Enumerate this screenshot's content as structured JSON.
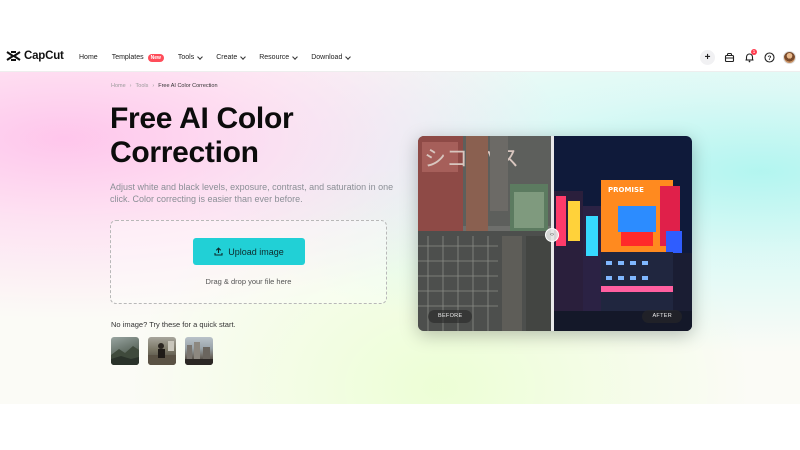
{
  "brand": {
    "name": "CapCut"
  },
  "nav": {
    "items": [
      {
        "label": "Home",
        "dropdown": false
      },
      {
        "label": "Templates",
        "dropdown": false,
        "badge": "New"
      },
      {
        "label": "Tools",
        "dropdown": true
      },
      {
        "label": "Create",
        "dropdown": true
      },
      {
        "label": "Resource",
        "dropdown": true
      },
      {
        "label": "Download",
        "dropdown": true
      }
    ],
    "right": {
      "add_icon": "plus-icon",
      "bag_icon": "bag-icon",
      "bell_icon": "bell-icon",
      "bell_count": "1",
      "help_icon": "help-icon",
      "avatar": "avatar"
    }
  },
  "breadcrumb": [
    "Home",
    "Tools",
    "Free AI Color Correction"
  ],
  "hero": {
    "title": "Free AI Color Correction",
    "subtitle": "Adjust white and black levels, exposure, contrast, and saturation in one click. Color correcting is easier than ever before.",
    "upload_label": "Upload image",
    "drag_text": "Drag & drop your file here",
    "no_image_text": "No image? Try these for a quick start."
  },
  "compare": {
    "before_label": "BEFORE",
    "after_label": "AFTER",
    "handle_icon": "split-handle-icon",
    "sign_text_left": "シコ パス",
    "sign_text_right": "PROMISE"
  },
  "colors": {
    "accent": "#21d0d6",
    "badge": "#ff4d5a",
    "notify": "#ff3b4e"
  }
}
